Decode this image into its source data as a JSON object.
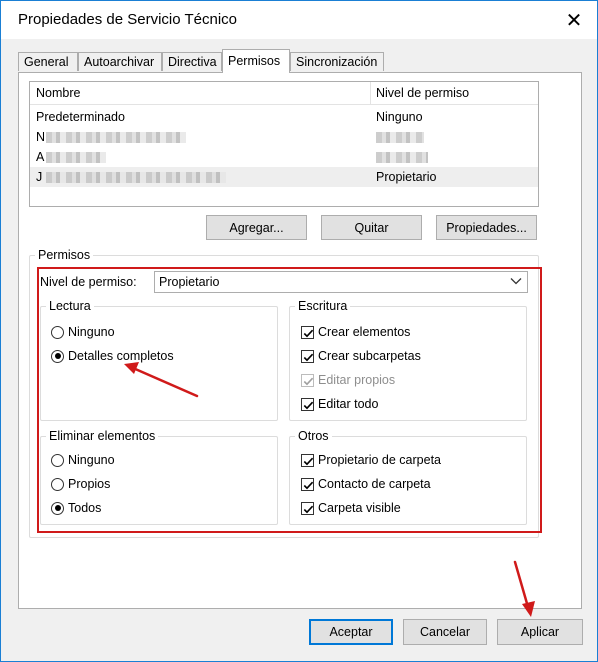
{
  "window": {
    "title": "Propiedades de Servicio Técnico",
    "close_glyph": "✕"
  },
  "tabs": [
    {
      "label": "General"
    },
    {
      "label": "Autoarchivar"
    },
    {
      "label": "Directiva"
    },
    {
      "label": "Permisos",
      "active": true
    },
    {
      "label": "Sincronización"
    }
  ],
  "users_list": {
    "headers": {
      "name": "Nombre",
      "level": "Nivel de permiso"
    },
    "rows": [
      {
        "name": "Predeterminado",
        "level": "Ninguno"
      },
      {
        "name": "N",
        "level": ""
      },
      {
        "name": "A",
        "level": ""
      },
      {
        "name": "J",
        "level": "Propietario"
      }
    ]
  },
  "list_buttons": {
    "add": "Agregar...",
    "remove": "Quitar",
    "properties": "Propiedades..."
  },
  "permissions": {
    "legend": "Permisos",
    "level_label": "Nivel de permiso:",
    "level_value": "Propietario",
    "read": {
      "legend": "Lectura",
      "options": [
        {
          "label": "Ninguno",
          "selected": false
        },
        {
          "label": "Detalles completos",
          "selected": true
        }
      ]
    },
    "write": {
      "legend": "Escritura",
      "options": [
        {
          "label": "Crear elementos",
          "checked": true,
          "disabled": false
        },
        {
          "label": "Crear subcarpetas",
          "checked": true,
          "disabled": false
        },
        {
          "label": "Editar propios",
          "checked": true,
          "disabled": true
        },
        {
          "label": "Editar todo",
          "checked": true,
          "disabled": false
        }
      ]
    },
    "delete": {
      "legend": "Eliminar elementos",
      "options": [
        {
          "label": "Ninguno",
          "selected": false
        },
        {
          "label": "Propios",
          "selected": false
        },
        {
          "label": "Todos",
          "selected": true
        }
      ]
    },
    "other": {
      "legend": "Otros",
      "options": [
        {
          "label": "Propietario de carpeta",
          "checked": true
        },
        {
          "label": "Contacto de carpeta",
          "checked": true
        },
        {
          "label": "Carpeta visible",
          "checked": true
        }
      ]
    }
  },
  "footer": {
    "accept": "Aceptar",
    "cancel": "Cancelar",
    "apply": "Aplicar"
  },
  "colors": {
    "annotation_red": "#d01a1a",
    "default_button_border": "#0078d7",
    "window_border": "#1a7fd4"
  }
}
